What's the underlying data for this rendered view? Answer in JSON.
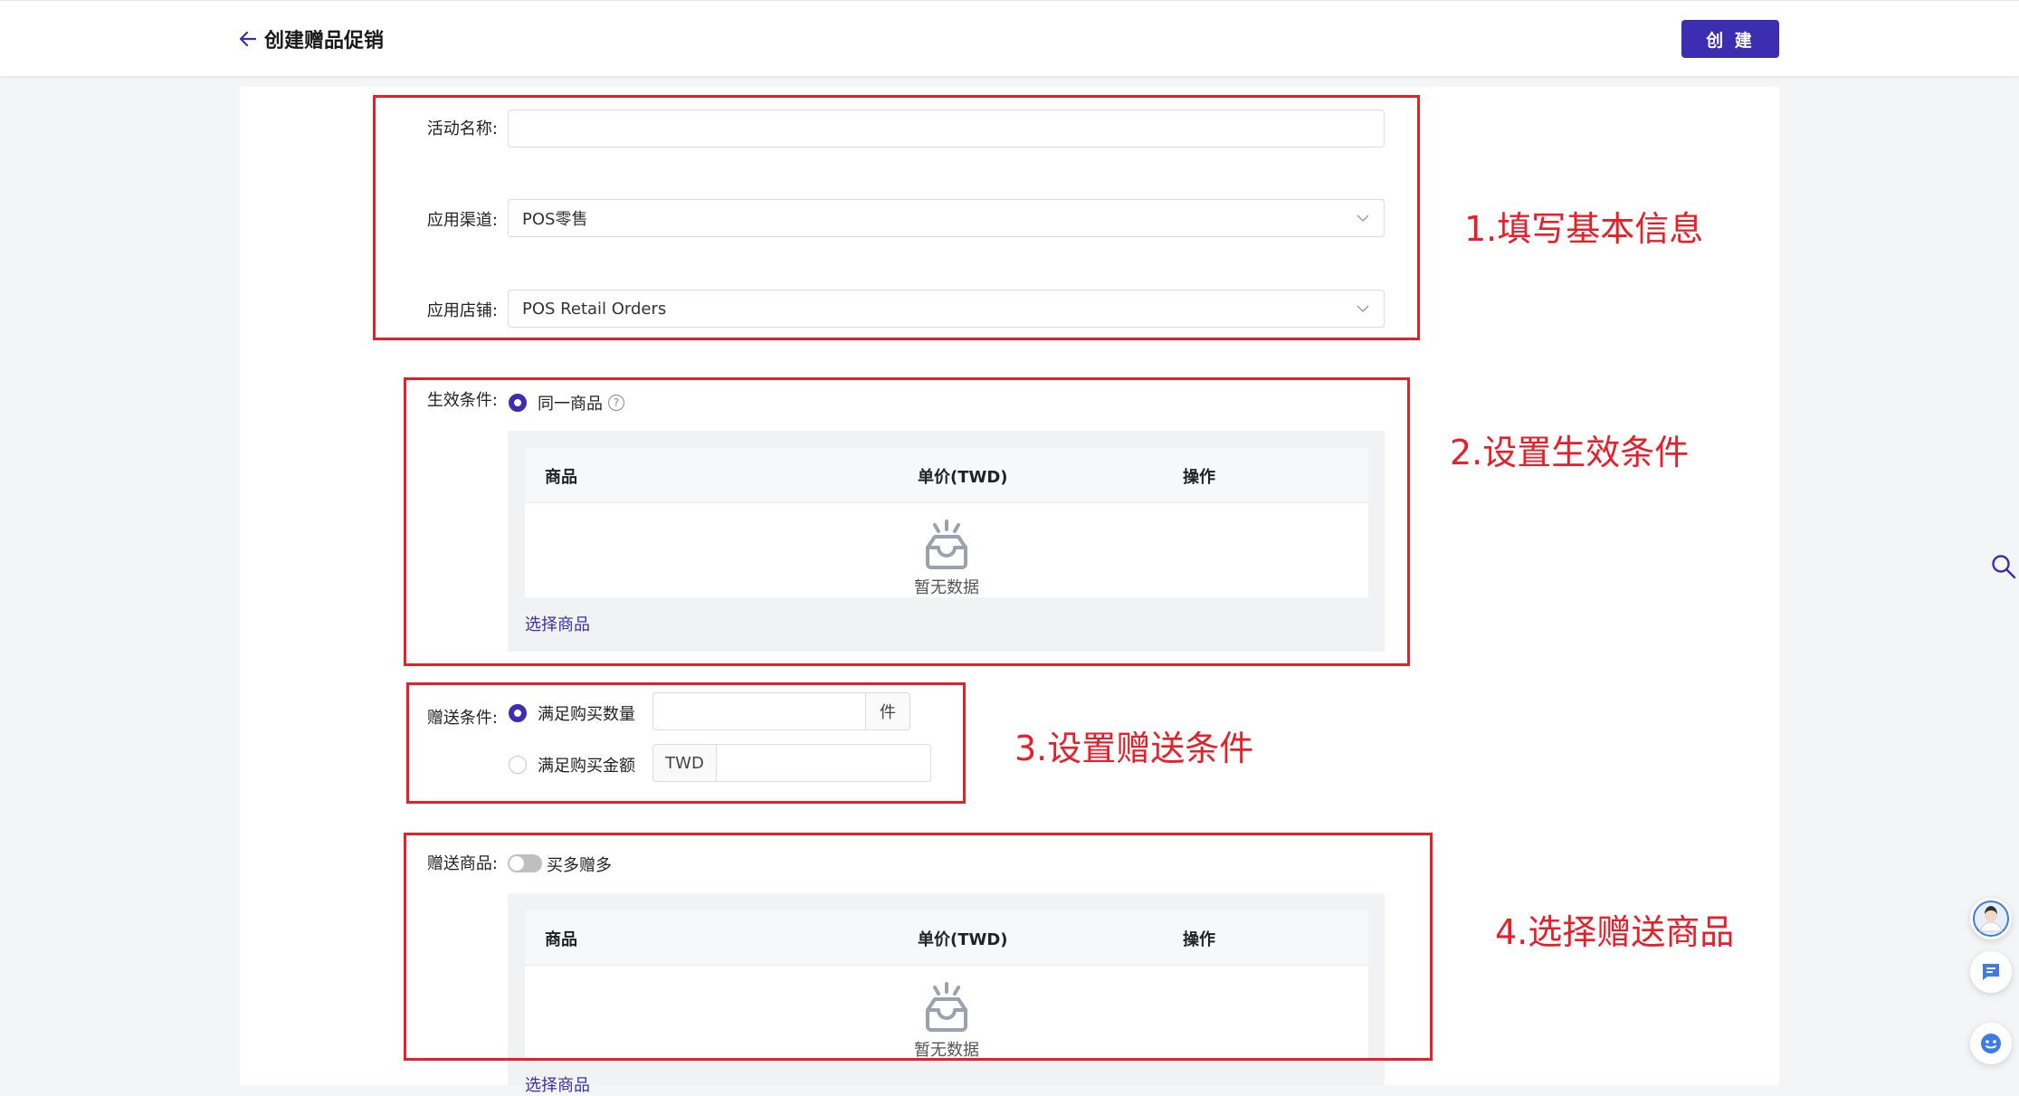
{
  "header": {
    "title": "创建赠品促销",
    "create_label": "创 建"
  },
  "form": {
    "activity_name": {
      "label": "活动名称:",
      "value": "",
      "placeholder": ""
    },
    "channel": {
      "label": "应用渠道:",
      "value": "POS零售"
    },
    "store": {
      "label": "应用店铺:",
      "value": "POS Retail Orders"
    },
    "effect": {
      "label": "生效条件:",
      "option_label": "同一商品",
      "table": {
        "col_product": "商品",
        "col_price": "单价(TWD)",
        "col_action": "操作",
        "empty_text": "暂无数据"
      },
      "select_link": "选择商品"
    },
    "gift_condition": {
      "label": "赠送条件:",
      "option_qty": "满足购买数量",
      "qty_unit": "件",
      "qty_value": "",
      "option_amount": "满足购买金额",
      "amount_currency": "TWD",
      "amount_value": ""
    },
    "gift_products": {
      "label": "赠送商品:",
      "toggle_label": "买多赠多",
      "table": {
        "col_product": "商品",
        "col_price": "单价(TWD)",
        "col_action": "操作",
        "empty_text": "暂无数据"
      },
      "select_link": "选择商品"
    }
  },
  "annotations": {
    "step1": "1.填写基本信息",
    "step2": "2.设置生效条件",
    "step3": "3.设置赠送条件",
    "step4": "4.选择赠送商品"
  },
  "colors": {
    "accent": "#3d2db0",
    "annotation": "#e5202a"
  }
}
